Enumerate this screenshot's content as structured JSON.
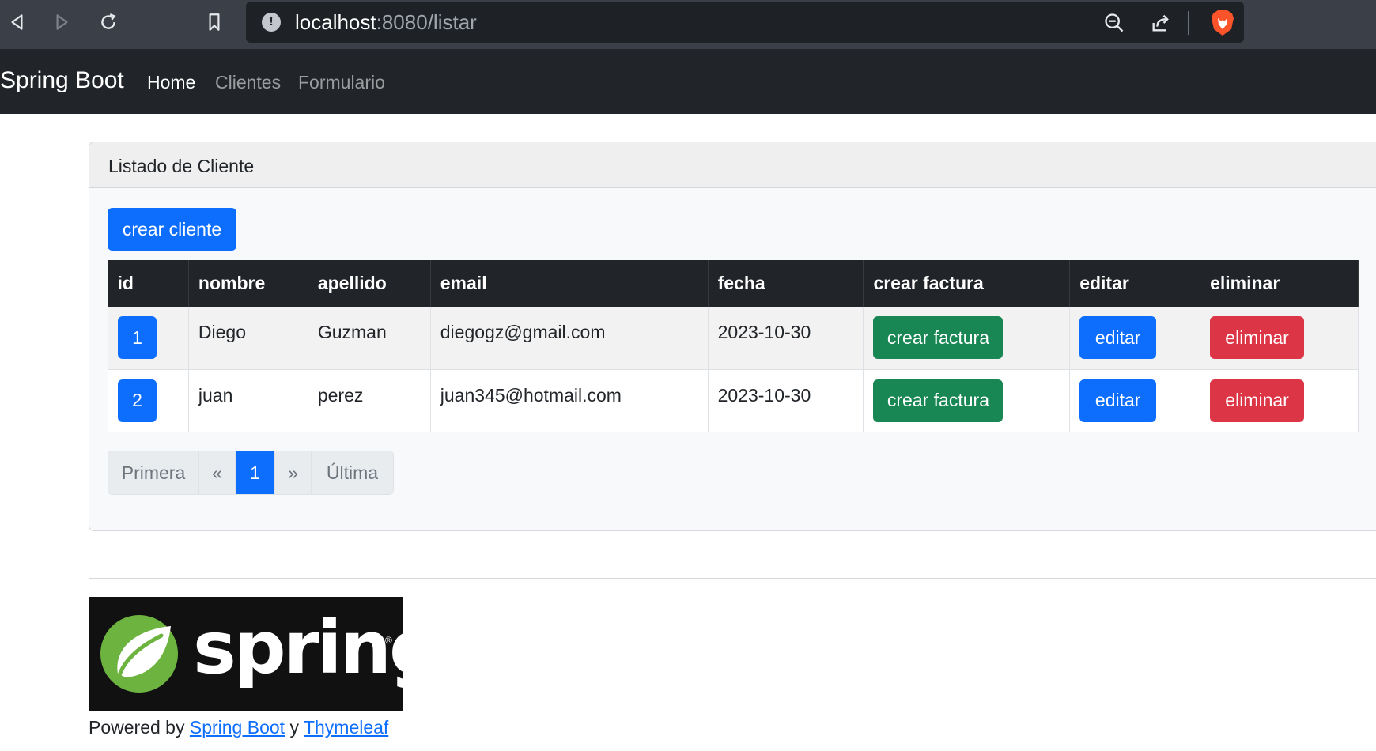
{
  "browser": {
    "url_host": "localhost",
    "url_rest": ":8080/listar",
    "icons": [
      "back-icon",
      "forward-icon",
      "reload-icon",
      "bookmark-icon",
      "info-icon",
      "zoom-out-icon",
      "share-icon",
      "brave-lion-icon"
    ]
  },
  "navbar": {
    "brand": "Spring Boot",
    "links": [
      "Home",
      "Clientes",
      "Formulario"
    ],
    "active": "Home"
  },
  "card": {
    "title": "Listado de Cliente",
    "create_button": "crear cliente"
  },
  "table": {
    "headers": [
      "id",
      "nombre",
      "apellido",
      "email",
      "fecha",
      "crear factura",
      "editar",
      "eliminar"
    ],
    "rows": [
      {
        "id": "1",
        "nombre": "Diego",
        "apellido": "Guzman",
        "email": "diegogz@gmail.com",
        "fecha": "2023-10-30",
        "factura": "crear factura",
        "editar": "editar",
        "eliminar": "eliminar"
      },
      {
        "id": "2",
        "nombre": "juan",
        "apellido": "perez",
        "email": "juan345@hotmail.com",
        "fecha": "2023-10-30",
        "factura": "crear factura",
        "editar": "editar",
        "eliminar": "eliminar"
      }
    ]
  },
  "pagination": {
    "first": "Primera",
    "prev": "«",
    "current": "1",
    "next": "»",
    "last": "Última"
  },
  "footer": {
    "logo_text": "spring",
    "powered_prefix": "Powered by",
    "link1": "Spring Boot",
    "conjunction": "y",
    "link2": "Thymeleaf"
  },
  "colors": {
    "primary": "#0d6efd",
    "success": "#198754",
    "danger": "#dc3545",
    "dark": "#212529",
    "spring_green": "#6db33f"
  }
}
